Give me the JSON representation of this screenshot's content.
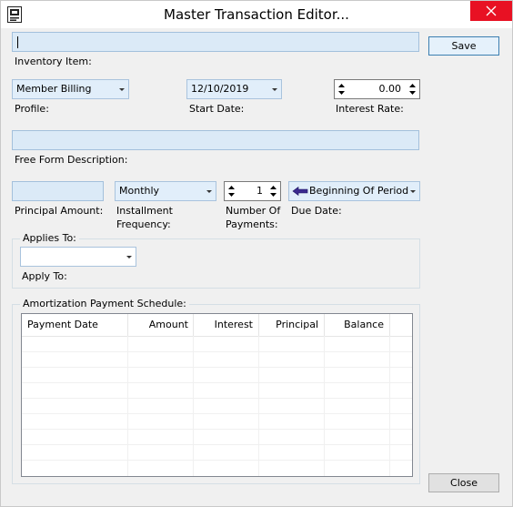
{
  "window": {
    "title": "Master Transaction Editor...",
    "app_icon": "document-icon",
    "close_icon": "close-x-icon"
  },
  "buttons": {
    "save": "Save",
    "close": "Close"
  },
  "inventory": {
    "value": "",
    "label": "Inventory Item:"
  },
  "profile": {
    "value": "Member Billing",
    "label": "Profile:"
  },
  "start_date": {
    "value": "12/10/2019",
    "label": "Start Date:"
  },
  "interest_rate": {
    "value": "0.00",
    "label": "Interest Rate:"
  },
  "free_form": {
    "value": "",
    "label": "Free Form Description:"
  },
  "principal": {
    "value": "",
    "label": "Principal Amount:"
  },
  "installment": {
    "value": "Monthly",
    "label_line1": "Installment",
    "label_line2": "Frequency:"
  },
  "num_payments": {
    "value": "1",
    "label_line1": "Number Of",
    "label_line2": "Payments:"
  },
  "due_date": {
    "value": "Beginning Of Period",
    "label": "Due Date:",
    "icon": "arrow-left-icon"
  },
  "applies_to": {
    "group_title": "Applies To:",
    "value": "",
    "label": "Apply To:"
  },
  "schedule": {
    "group_title": "Amortization Payment Schedule:",
    "columns": [
      "Payment Date",
      "Amount",
      "Interest",
      "Principal",
      "Balance"
    ],
    "rows": []
  },
  "colors": {
    "field_bg": "#dbeaf7",
    "field_border": "#a3c0dc",
    "close_btn": "#e81123",
    "default_button_border": "#3c7fb1"
  }
}
